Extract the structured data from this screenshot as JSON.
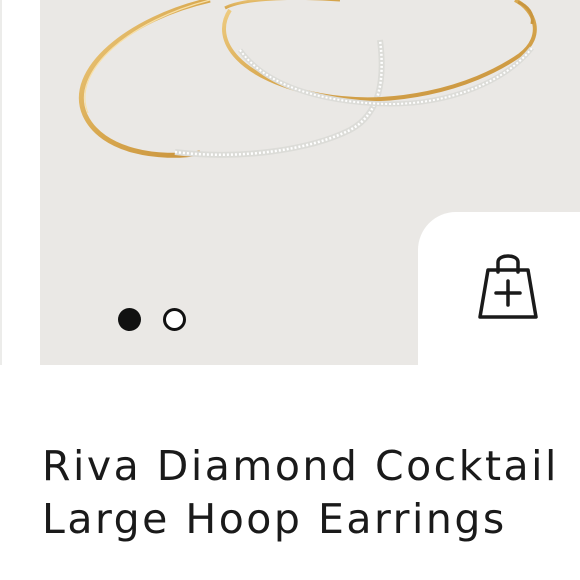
{
  "product": {
    "title": "Riva Diamond Cocktail Large Hoop Earrings",
    "image": {
      "name": "hoop-earrings-photo",
      "background_color": "#eae8e5",
      "metal_color": "#d9ad5a",
      "pave_color": "#f4f4f2"
    }
  },
  "gallery": {
    "slide_count": 2,
    "active_slide": 1,
    "indicators": [
      {
        "state": "active"
      },
      {
        "state": "inactive"
      }
    ]
  },
  "actions": {
    "add_to_bag_icon": "shopping-bag-plus-icon"
  }
}
